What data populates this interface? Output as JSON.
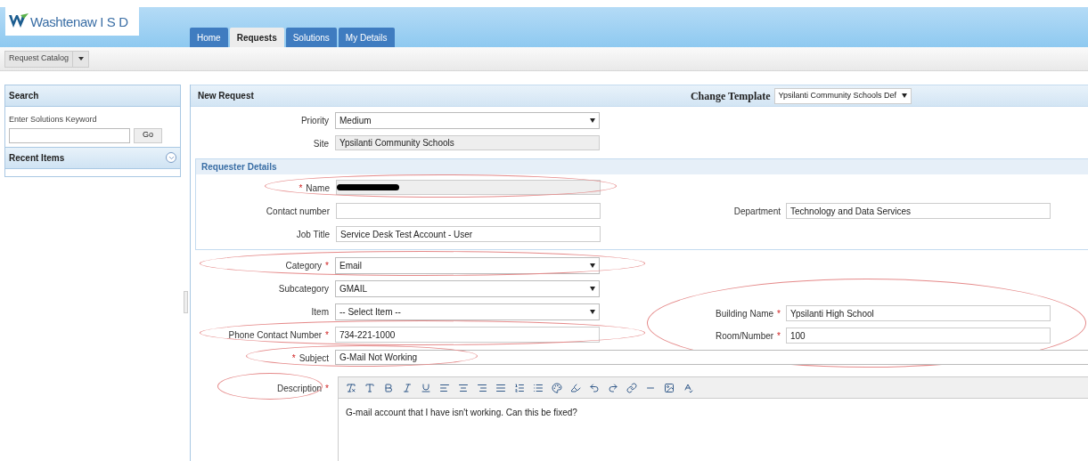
{
  "logo": {
    "name": "Washtenaw I S D"
  },
  "tabs": [
    {
      "label": "Home",
      "selected": false
    },
    {
      "label": "Requests",
      "selected": true
    },
    {
      "label": "Solutions",
      "selected": false
    },
    {
      "label": "My Details",
      "selected": false
    }
  ],
  "toolbar": {
    "button": "Request Catalog"
  },
  "sidebar": {
    "search": {
      "title": "Search",
      "label": "Enter Solutions Keyword",
      "button": "Go"
    },
    "recent": {
      "title": "Recent Items",
      "expanded": false
    }
  },
  "form": {
    "title": "New Request",
    "template_label": "Change Template",
    "template_value": "Ypsilanti Community Schools Def",
    "top_fields": [
      {
        "label": "Priority",
        "kind": "select",
        "value": "Medium",
        "circled": false
      },
      {
        "label": "Site",
        "kind": "readonly",
        "value": "Ypsilanti Community Schools",
        "circled": false
      }
    ],
    "requester": {
      "title": "Requester Details",
      "fields": [
        {
          "label": "Name",
          "mark_before": "*",
          "kind": "redacted",
          "circled": true
        },
        {
          "label": "Contact number",
          "kind": "text",
          "circled": false,
          "right": {
            "label": "Department",
            "kind": "text",
            "value": "Technology and Data Services"
          }
        },
        {
          "label": "Job Title",
          "kind": "text",
          "value": "Service Desk Test Account - User",
          "circled": false
        }
      ]
    },
    "fields": [
      {
        "label": "Category",
        "mark_after": "*",
        "kind": "select",
        "value": "Email",
        "circled": true
      },
      {
        "label": "Subcategory",
        "kind": "select",
        "value": "GMAIL",
        "circled": false
      },
      {
        "label": "Item",
        "kind": "select",
        "value": "-- Select Item --",
        "circled": false
      },
      {
        "label": "Phone Contact Number",
        "mark_after": "*",
        "kind": "text",
        "value": "734-221-1000",
        "circled": true
      }
    ],
    "side_group": {
      "circled": true,
      "fields": [
        {
          "label": "Building Name",
          "mark_after": "*",
          "kind": "text",
          "value": "Ypsilanti High School"
        },
        {
          "label": "Room/Number",
          "mark_after": "*",
          "kind": "text",
          "value": "100"
        }
      ]
    },
    "subject": {
      "label": "Subject",
      "mark_before": "*",
      "kind": "wide",
      "value": "G-Mail Not Working",
      "circled": true
    },
    "description": {
      "label": "Description",
      "mark_after": "*",
      "kind": "editor",
      "value": "G-mail account that I have isn't working. Can this be fixed?",
      "circled": true
    }
  }
}
